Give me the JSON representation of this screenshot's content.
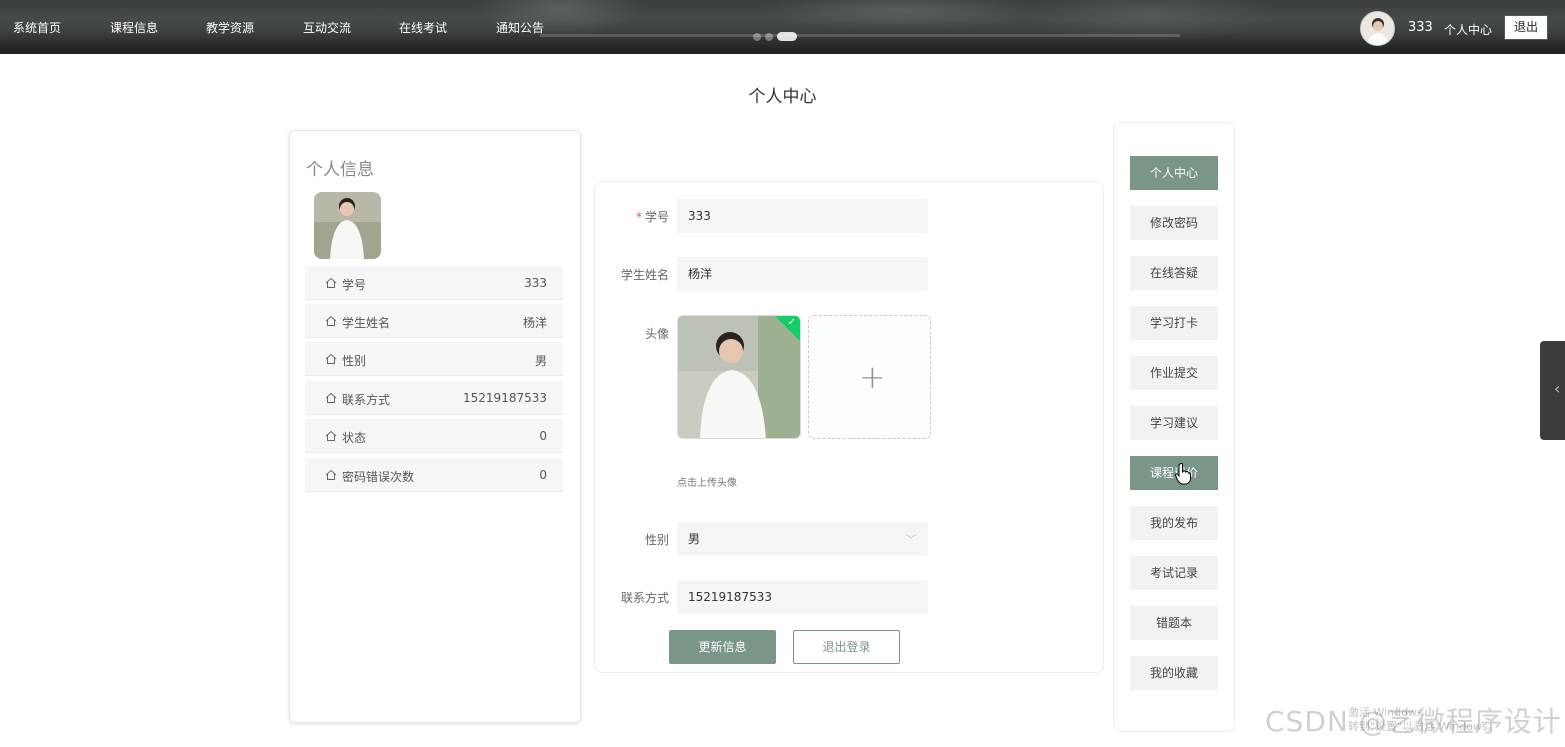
{
  "nav": {
    "items": [
      "系统首页",
      "课程信息",
      "教学资源",
      "互动交流",
      "在线考试",
      "通知公告"
    ],
    "username": "333",
    "center_label": "个人中心",
    "logout_label": "退出",
    "carousel_active": 2,
    "carousel_count": 3
  },
  "page": {
    "title": "个人中心"
  },
  "profile": {
    "title": "个人信息",
    "rows": [
      {
        "label": "学号",
        "value": "333"
      },
      {
        "label": "学生姓名",
        "value": "杨洋"
      },
      {
        "label": "性别",
        "value": "男"
      },
      {
        "label": "联系方式",
        "value": "15219187533"
      },
      {
        "label": "状态",
        "value": "0"
      },
      {
        "label": "密码错误次数",
        "value": "0"
      }
    ],
    "icon": "home-outline-icon"
  },
  "form": {
    "student_id_label": "学号",
    "student_id_value": "333",
    "name_label": "学生姓名",
    "name_value": "杨洋",
    "avatar_label": "头像",
    "upload_tip": "点击上传头像",
    "gender_label": "性别",
    "gender_value": "男",
    "phone_label": "联系方式",
    "phone_value": "15219187533",
    "update_button": "更新信息",
    "logout_button": "退出登录"
  },
  "menu": {
    "items": [
      "个人中心",
      "修改密码",
      "在线答疑",
      "学习打卡",
      "作业提交",
      "学习建议",
      "课程评价",
      "我的发布",
      "考试记录",
      "错题本",
      "我的收藏"
    ],
    "active": [
      0,
      6
    ]
  },
  "watermark": {
    "text": "CSDN @艺微程序设计",
    "windows_note_1": "激活 Windows",
    "windows_note_2": "转到\"设置\"以激活 Windows。"
  },
  "colors": {
    "accent": "#7a9687",
    "success": "#13ce66",
    "required": "#e05c5c"
  }
}
